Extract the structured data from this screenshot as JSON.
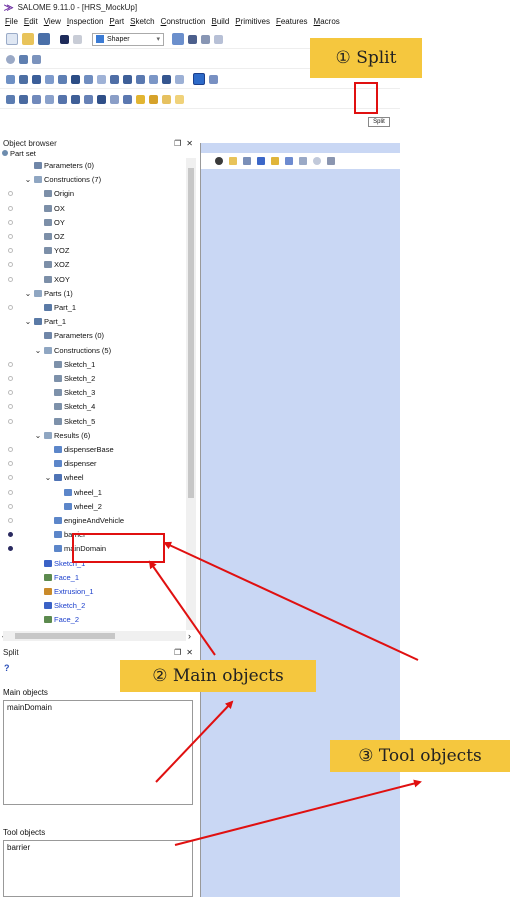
{
  "window": {
    "title": "SALOME 9.11.0 - [HRS_MockUp]"
  },
  "menu": [
    "File",
    "Edit",
    "View",
    "Inspection",
    "Part",
    "Sketch",
    "Construction",
    "Build",
    "Primitives",
    "Features",
    "Macros"
  ],
  "toolbar": {
    "module_combo": "Shaper",
    "split_tooltip": "Split"
  },
  "object_browser": {
    "title": "Object browser",
    "root": "Part set",
    "rows": [
      {
        "label": "Parameters (0)",
        "icon": "params-icon",
        "indent": 1,
        "chev": "",
        "eye": "none",
        "blue": false
      },
      {
        "label": "Constructions (7)",
        "icon": "folder-icon",
        "indent": 1,
        "chev": "v",
        "eye": "none",
        "blue": false
      },
      {
        "label": "Origin",
        "icon": "point-icon",
        "indent": 2,
        "chev": "",
        "eye": "open",
        "blue": false
      },
      {
        "label": "OX",
        "icon": "axis-icon",
        "indent": 2,
        "chev": "",
        "eye": "open",
        "blue": false
      },
      {
        "label": "OY",
        "icon": "axis-icon",
        "indent": 2,
        "chev": "",
        "eye": "open",
        "blue": false
      },
      {
        "label": "OZ",
        "icon": "axis-icon",
        "indent": 2,
        "chev": "",
        "eye": "open",
        "blue": false
      },
      {
        "label": "YOZ",
        "icon": "plane-icon",
        "indent": 2,
        "chev": "",
        "eye": "open",
        "blue": false
      },
      {
        "label": "XOZ",
        "icon": "plane-icon",
        "indent": 2,
        "chev": "",
        "eye": "open",
        "blue": false
      },
      {
        "label": "XOY",
        "icon": "plane-icon",
        "indent": 2,
        "chev": "",
        "eye": "open",
        "blue": false
      },
      {
        "label": "Parts (1)",
        "icon": "folder-icon",
        "indent": 1,
        "chev": "v",
        "eye": "none",
        "blue": false
      },
      {
        "label": "Part_1",
        "icon": "part-icon",
        "indent": 2,
        "chev": "",
        "eye": "open",
        "blue": false
      },
      {
        "label": "Part_1",
        "icon": "part-icon",
        "indent": 1,
        "chev": "v",
        "eye": "none",
        "blue": false
      },
      {
        "label": "Parameters (0)",
        "icon": "params-icon",
        "indent": 2,
        "chev": "",
        "eye": "none",
        "blue": false
      },
      {
        "label": "Constructions (5)",
        "icon": "folder-icon",
        "indent": 2,
        "chev": "v",
        "eye": "none",
        "blue": false
      },
      {
        "label": "Sketch_1",
        "icon": "sketch-icon",
        "indent": 3,
        "chev": "",
        "eye": "open",
        "blue": false
      },
      {
        "label": "Sketch_2",
        "icon": "sketch-icon",
        "indent": 3,
        "chev": "",
        "eye": "open",
        "blue": false
      },
      {
        "label": "Sketch_3",
        "icon": "sketch-icon",
        "indent": 3,
        "chev": "",
        "eye": "open",
        "blue": false
      },
      {
        "label": "Sketch_4",
        "icon": "sketch-icon",
        "indent": 3,
        "chev": "",
        "eye": "open",
        "blue": false
      },
      {
        "label": "Sketch_5",
        "icon": "sketch-icon",
        "indent": 3,
        "chev": "",
        "eye": "open",
        "blue": false
      },
      {
        "label": "Results (6)",
        "icon": "folder-icon",
        "indent": 2,
        "chev": "v",
        "eye": "none",
        "blue": false
      },
      {
        "label": "dispenserBase",
        "icon": "solid-icon",
        "indent": 3,
        "chev": "",
        "eye": "open",
        "blue": false
      },
      {
        "label": "dispenser",
        "icon": "solid-icon",
        "indent": 3,
        "chev": "",
        "eye": "open",
        "blue": false
      },
      {
        "label": "wheel",
        "icon": "compound-icon",
        "indent": 3,
        "chev": "v",
        "eye": "open",
        "blue": false
      },
      {
        "label": "wheel_1",
        "icon": "solid-icon",
        "indent": 4,
        "chev": "",
        "eye": "open",
        "blue": false
      },
      {
        "label": "wheel_2",
        "icon": "solid-icon",
        "indent": 4,
        "chev": "",
        "eye": "open",
        "blue": false
      },
      {
        "label": "engineAndVehicle",
        "icon": "solid-icon",
        "indent": 3,
        "chev": "",
        "eye": "open",
        "blue": false
      },
      {
        "label": "barrier",
        "icon": "solid-icon",
        "indent": 3,
        "chev": "",
        "eye": "filled",
        "blue": false
      },
      {
        "label": "mainDomain",
        "icon": "solid-icon",
        "indent": 3,
        "chev": "",
        "eye": "filled",
        "blue": false
      },
      {
        "label": "Sketch_1",
        "icon": "sketch-feature-icon",
        "indent": 2,
        "chev": "",
        "eye": "none",
        "blue": true
      },
      {
        "label": "Face_1",
        "icon": "face-icon",
        "indent": 2,
        "chev": "",
        "eye": "none",
        "blue": true
      },
      {
        "label": "Extrusion_1",
        "icon": "extrusion-icon",
        "indent": 2,
        "chev": "",
        "eye": "none",
        "blue": true
      },
      {
        "label": "Sketch_2",
        "icon": "sketch-feature-icon",
        "indent": 2,
        "chev": "",
        "eye": "none",
        "blue": true
      },
      {
        "label": "Face_2",
        "icon": "face-icon",
        "indent": 2,
        "chev": "",
        "eye": "none",
        "blue": true
      }
    ]
  },
  "split_panel": {
    "title": "Split",
    "help": "?",
    "main_label": "Main objects",
    "main_items": [
      "mainDomain"
    ],
    "tool_label": "Tool objects",
    "tool_items": [
      "barrier"
    ]
  },
  "annotations": {
    "c1": "① Split",
    "c2": "② Main objects",
    "c3": "③ Tool objects",
    "color_callout": "#f5c73e",
    "color_arrow": "#e01010"
  }
}
